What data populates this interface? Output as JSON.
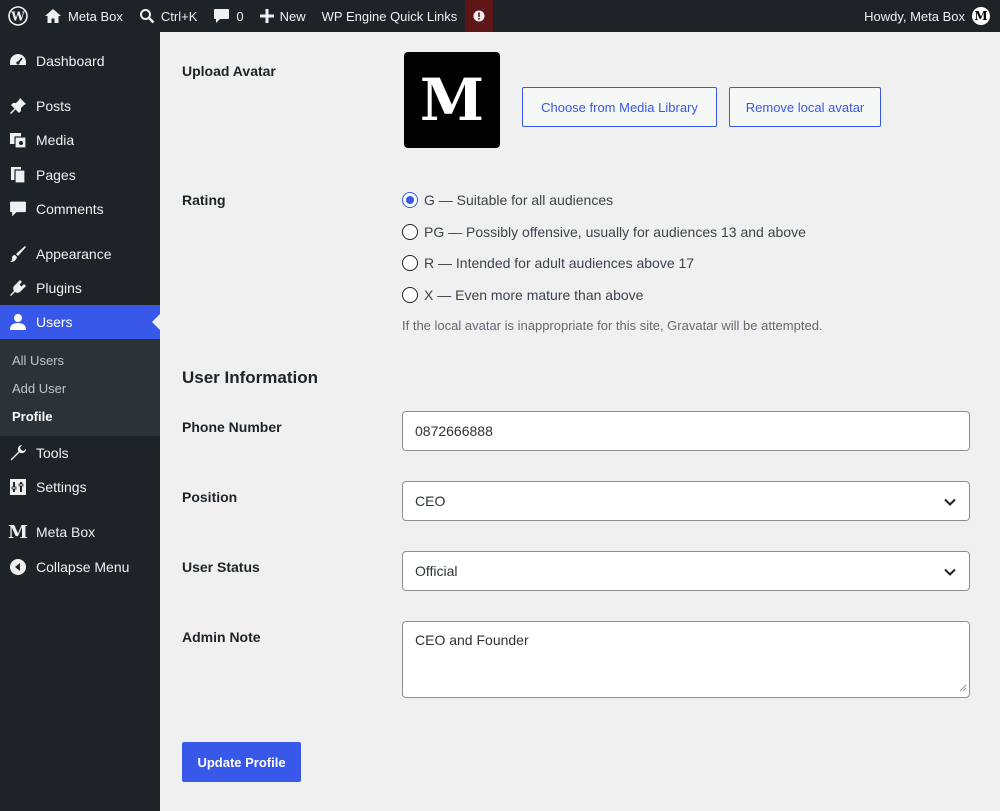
{
  "adminbar": {
    "site_name": "Meta Box",
    "search_shortcut": "Ctrl+K",
    "comments_count": "0",
    "new_label": "New",
    "quick_links": "WP Engine Quick Links",
    "greeting": "Howdy, Meta Box",
    "avatar_letter": "M"
  },
  "sidebar": {
    "items": [
      {
        "label": "Dashboard",
        "icon": "dashboard-icon"
      },
      {
        "label": "Posts",
        "icon": "pin-icon"
      },
      {
        "label": "Media",
        "icon": "media-icon"
      },
      {
        "label": "Pages",
        "icon": "pages-icon"
      },
      {
        "label": "Comments",
        "icon": "comment-icon"
      },
      {
        "label": "Appearance",
        "icon": "brush-icon"
      },
      {
        "label": "Plugins",
        "icon": "plug-icon"
      },
      {
        "label": "Users",
        "icon": "user-icon"
      },
      {
        "label": "Tools",
        "icon": "wrench-icon"
      },
      {
        "label": "Settings",
        "icon": "settings-icon"
      },
      {
        "label": "Meta Box",
        "icon": "metabox-logo-icon"
      },
      {
        "label": "Collapse Menu",
        "icon": "collapse-icon"
      }
    ],
    "submenu": [
      "All Users",
      "Add User",
      "Profile"
    ],
    "metabox_logo_letter": "M",
    "accent_color": "#3858e9"
  },
  "avatar": {
    "label": "Upload Avatar",
    "letter": "M",
    "choose_button": "Choose from Media Library",
    "remove_button": "Remove local avatar"
  },
  "rating": {
    "label": "Rating",
    "options": [
      {
        "text": "G — Suitable for all audiences",
        "checked": true
      },
      {
        "text": "PG — Possibly offensive, usually for audiences 13 and above",
        "checked": false
      },
      {
        "text": "R — Intended for adult audiences above 17",
        "checked": false
      },
      {
        "text": "X — Even more mature than above",
        "checked": false
      }
    ],
    "description": "If the local avatar is inappropriate for this site, Gravatar will be attempted."
  },
  "user_info": {
    "title": "User Information",
    "phone_label": "Phone Number",
    "phone_value": "0872666888",
    "position_label": "Position",
    "position_value": "CEO",
    "status_label": "User Status",
    "status_value": "Official",
    "note_label": "Admin Note",
    "note_value": "CEO and Founder"
  },
  "submit_label": "Update Profile"
}
